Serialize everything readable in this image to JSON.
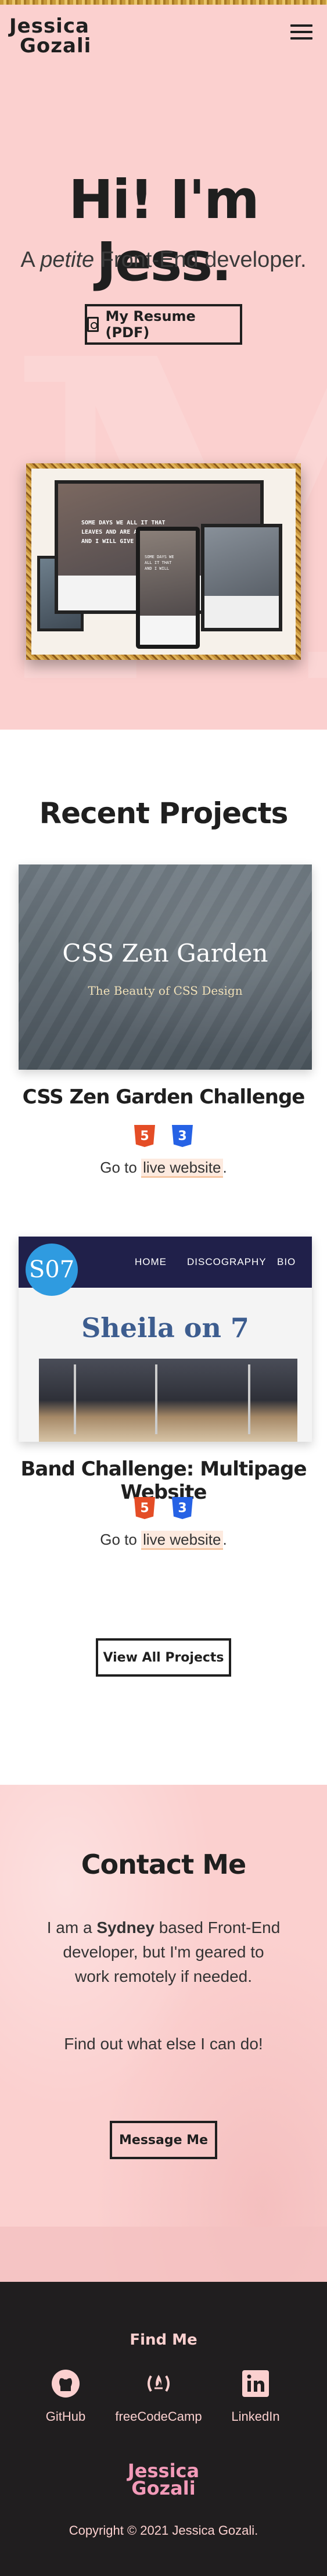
{
  "header": {
    "logo_line1": "Jessica",
    "logo_line2": "Gozali",
    "menu_icon": "hamburger-menu-icon"
  },
  "hero": {
    "title": "Hi! I'm Jess.",
    "subtitle_pre": "A ",
    "subtitle_em": "petite",
    "subtitle_post": " Front-End developer.",
    "resume_label": "My Resume (PDF)",
    "resume_icon": "pdf-file-icon",
    "mockup_text_line1": "SOME DAYS WE ALL IT THAT",
    "mockup_text_line2": "LEAVES AND ARE A",
    "mockup_text_line3": "AND I WILL GIVE IT",
    "phone_text_line1": "SOME DAYS WE",
    "phone_text_line2": "ALL IT THAT",
    "phone_text_line3": "AND I WILL"
  },
  "projects": {
    "title": "Recent Projects",
    "items": [
      {
        "name": "CSS Zen Garden Challenge",
        "image_title": "CSS Zen Garden",
        "image_subtitle": "The Beauty of CSS Design",
        "go_pre": "Go to ",
        "link_label": "live website",
        "go_post": "."
      },
      {
        "name": "Band Challenge: Multipage Website",
        "image_logo": "S07",
        "image_nav": [
          "HOME",
          "DISCOGRAPHY",
          "BIO"
        ],
        "image_title": "Sheila on 7",
        "go_pre": "Go to ",
        "link_label": "live website",
        "go_post": "."
      }
    ],
    "tech_labels": [
      "5",
      "3"
    ],
    "view_all_label": "View All Projects"
  },
  "contact": {
    "title": "Contact Me",
    "text_pre": "I am a ",
    "text_bold": "Sydney",
    "text_post": " based Front-End developer, but I'm geared to work remotely if needed.",
    "more": "Find out what else I can do!",
    "message_label": "Message Me"
  },
  "footer": {
    "find_me": "Find Me",
    "links": [
      {
        "label": "GitHub",
        "icon": "github-icon"
      },
      {
        "label": "freeCodeCamp",
        "icon": "freecodecamp-icon"
      },
      {
        "label": "LinkedIn",
        "icon": "linkedin-icon"
      }
    ],
    "logo_line1": "Jessica",
    "logo_line2": "Gozali",
    "copyright": "Copyright © 2021 Jessica Gozali."
  },
  "colors": {
    "pink": "#fbd0cf",
    "dark": "#201e1f",
    "html5": "#e44d26",
    "css3": "#2662e5",
    "accent_pink": "#f29ab8"
  }
}
